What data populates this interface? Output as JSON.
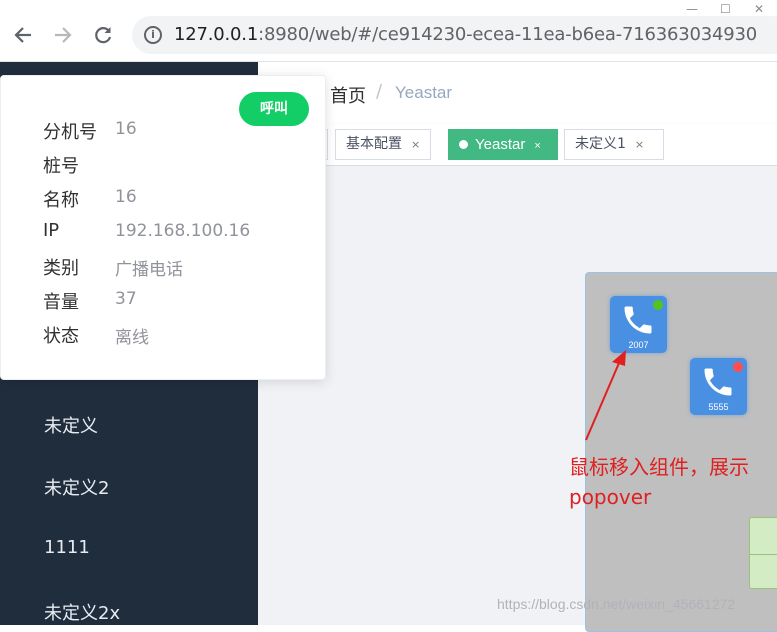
{
  "browser": {
    "window_controls": {
      "minimize": "—",
      "maximize": "☐",
      "close": "✕"
    },
    "url_host": "127.0.0.1",
    "url_rest": ":8980/web/#/ce914230-ecea-11ea-b6ea-716363034930"
  },
  "sidebar": {
    "items": [
      {
        "label": "未定义"
      },
      {
        "label": "未定义2"
      },
      {
        "label": "1111"
      },
      {
        "label": "未定义2x"
      }
    ]
  },
  "breadcrumb": {
    "home": "首页",
    "separator": "/",
    "current": "Yeastar"
  },
  "tags": [
    {
      "label": "基本配置",
      "close": "×"
    },
    {
      "label": "Yeastar",
      "close": "×",
      "active": true
    },
    {
      "label": "未定义1",
      "close": "×"
    }
  ],
  "popover": {
    "call_button": "呼叫",
    "rows": [
      {
        "label": "分机号",
        "value": "16"
      },
      {
        "label": "桩号",
        "value": ""
      },
      {
        "label": "名称",
        "value": "16"
      },
      {
        "label": "IP",
        "value": "192.168.100.16"
      },
      {
        "label": "类别",
        "value": "广播电话"
      },
      {
        "label": "音量",
        "value": "37"
      },
      {
        "label": "状态",
        "value": "离线"
      }
    ]
  },
  "canvas": {
    "phones": [
      {
        "number": "2007",
        "status_color": "#52c41a"
      },
      {
        "number": "5555",
        "status_color": "#ff4d4f"
      }
    ]
  },
  "annotation": {
    "line1": "鼠标移入组件，展示",
    "line2": "popover"
  },
  "watermark": "https://blog.csdn.net/weixin_45661272"
}
